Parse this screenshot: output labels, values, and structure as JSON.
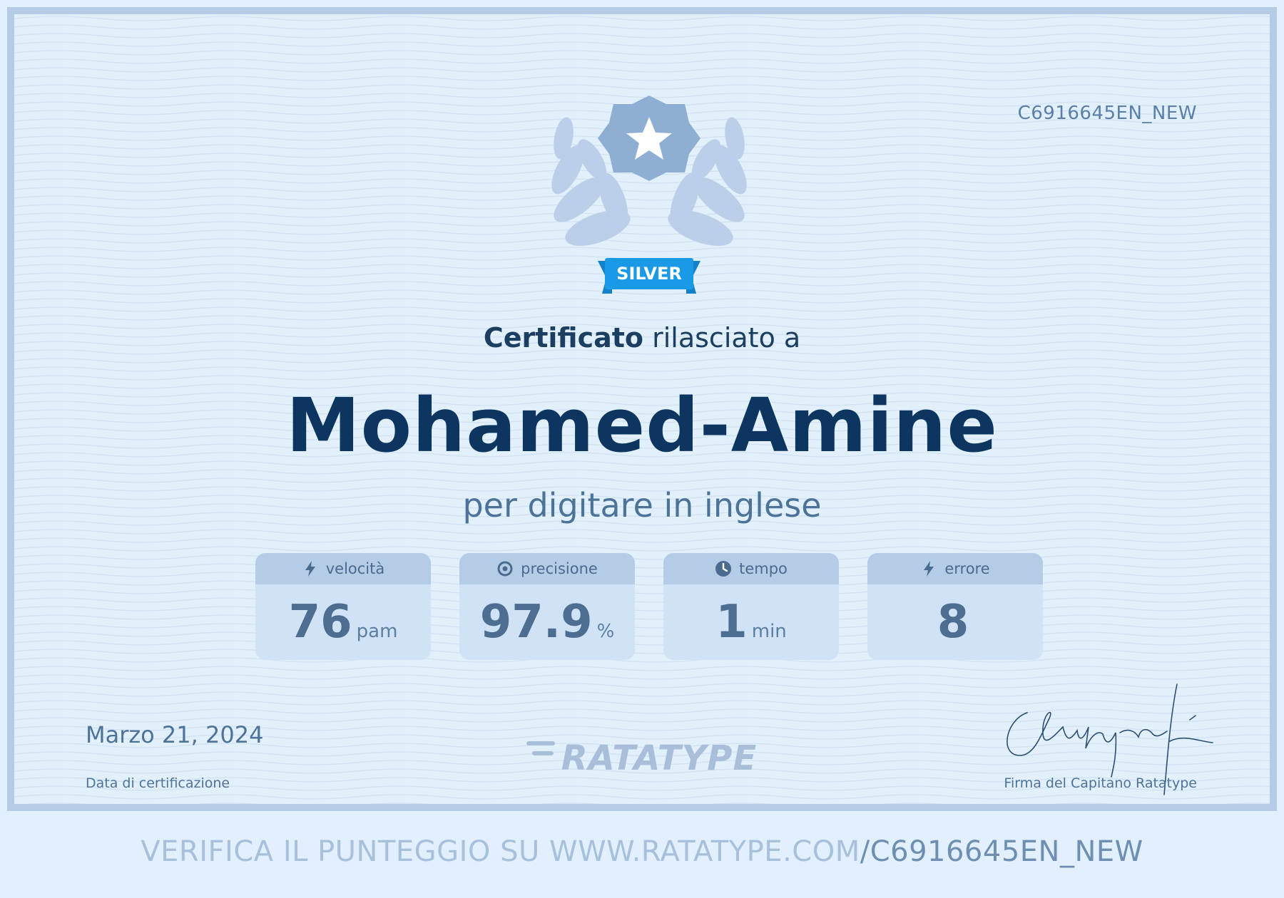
{
  "certificate": {
    "code": "C6916645EN_NEW",
    "badge": "SILVER",
    "title_bold": "Certificato",
    "title_rest": "rilasciato a",
    "recipient": "Mohamed-Amine",
    "subtitle": "per digitare in inglese",
    "stats": [
      {
        "label": "velocità",
        "value": "76",
        "unit": "pam",
        "icon": "lightning-icon"
      },
      {
        "label": "precisione",
        "value": "97.9",
        "unit": "%",
        "icon": "target-icon"
      },
      {
        "label": "tempo",
        "value": "1",
        "unit": "min",
        "icon": "clock-icon"
      },
      {
        "label": "errore",
        "value": "8",
        "unit": "",
        "icon": "lightning-icon"
      }
    ],
    "date": "Marzo 21, 2024",
    "date_label": "Data di certificazione",
    "logo": "RATATYPE",
    "signature_label": "Firma del Capitano Ratatype"
  },
  "footer": {
    "verify_text": "VERIFICA IL PUNTEGGIO SU WWW.RATATYPE.COM",
    "verify_code": "/C6916645EN_NEW"
  },
  "colors": {
    "background": "#e2f0fc",
    "border": "#b6cbe6",
    "name": "#0c3560",
    "accent_badge": "#1a9ae6",
    "emblem": "#8eaed4"
  }
}
